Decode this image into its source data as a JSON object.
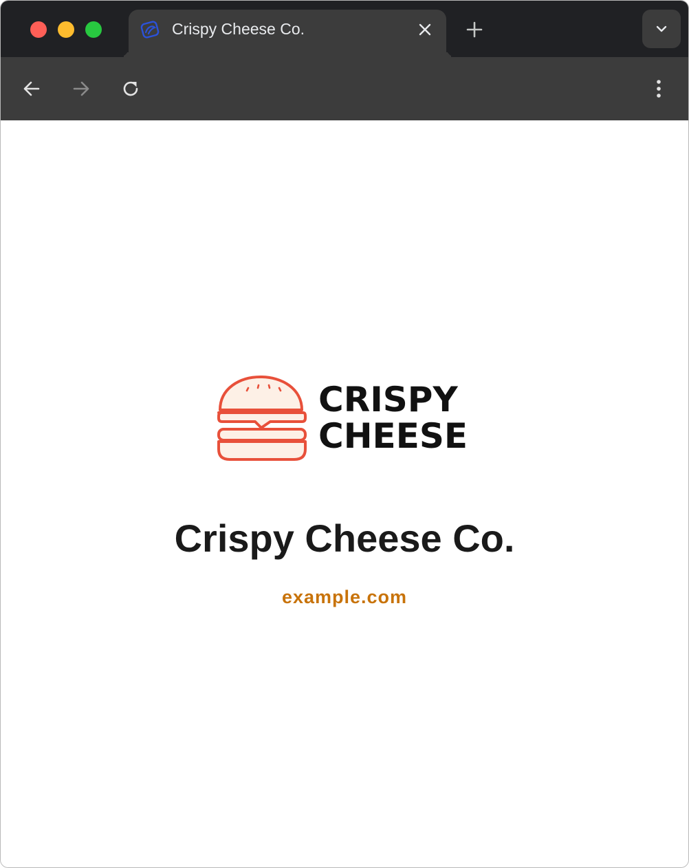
{
  "browser": {
    "tab": {
      "title": "Crispy Cheese Co.",
      "favicon": "orbit-logo-icon"
    },
    "buttons": {
      "close_tab": "close-icon",
      "new_tab": "plus-icon",
      "tab_search": "chevron-down-icon",
      "back": "arrow-left-icon",
      "forward": "arrow-right-icon",
      "reload": "reload-icon",
      "menu": "more-vertical-icon"
    }
  },
  "page": {
    "logo": {
      "line1": "CRISPY",
      "line2": "CHEESE"
    },
    "title": "Crispy Cheese Co.",
    "domain": "example.com"
  },
  "colors": {
    "tabstrip": "#202124",
    "toolbar": "#3c3c3c",
    "burger_stroke": "#e8503a",
    "burger_fill": "#fdf0e6",
    "domain_text": "#c8730a"
  }
}
